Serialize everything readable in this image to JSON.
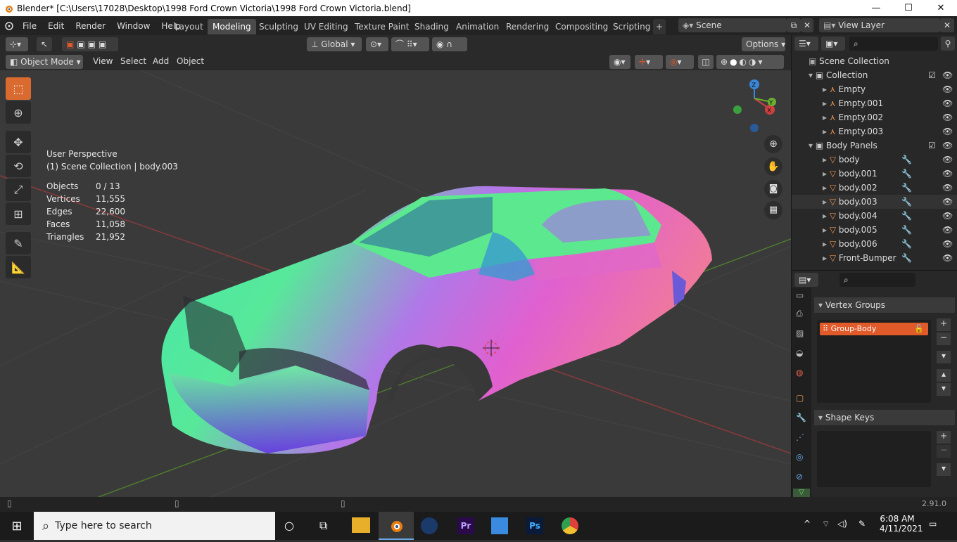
{
  "window": {
    "title": "Blender* [C:\\Users\\17028\\Desktop\\1998 Ford Crown Victoria\\1998 Ford Crown Victoria.blend]",
    "min": "—",
    "max": "☐",
    "close": "✕"
  },
  "menu": [
    "File",
    "Edit",
    "Render",
    "Window",
    "Help"
  ],
  "workspaces": [
    {
      "label": "Layout",
      "active": false
    },
    {
      "label": "Modeling",
      "active": true
    },
    {
      "label": "Sculpting",
      "active": false
    },
    {
      "label": "UV Editing",
      "active": false
    },
    {
      "label": "Texture Paint",
      "active": false
    },
    {
      "label": "Shading",
      "active": false
    },
    {
      "label": "Animation",
      "active": false
    },
    {
      "label": "Rendering",
      "active": false
    },
    {
      "label": "Compositing",
      "active": false
    },
    {
      "label": "Scripting",
      "active": false
    }
  ],
  "add_workspace": "+",
  "scene": {
    "name": "Scene",
    "view_layer": "View Layer"
  },
  "toolheader": {
    "orientation": "Global",
    "options": "Options"
  },
  "viewport_header": {
    "mode": "Object Mode",
    "menus": [
      "View",
      "Select",
      "Add",
      "Object"
    ]
  },
  "overlay": {
    "perspective": "User Perspective",
    "collection": "(1) Scene Collection | body.003"
  },
  "stats": [
    {
      "label": "Objects",
      "value": "0 / 13"
    },
    {
      "label": "Vertices",
      "value": "11,555"
    },
    {
      "label": "Edges",
      "value": "22,600"
    },
    {
      "label": "Faces",
      "value": "11,058"
    },
    {
      "label": "Triangles",
      "value": "21,952"
    }
  ],
  "gizmo": {
    "x": "X",
    "y": "Y",
    "z": "Z"
  },
  "outliner": {
    "root": "Scene Collection",
    "items": [
      {
        "label": "Collection",
        "type": "collection",
        "depth": 1
      },
      {
        "label": "Empty",
        "type": "empty",
        "depth": 2
      },
      {
        "label": "Empty.001",
        "type": "empty",
        "depth": 2
      },
      {
        "label": "Empty.002",
        "type": "empty",
        "depth": 2
      },
      {
        "label": "Empty.003",
        "type": "empty",
        "depth": 2
      },
      {
        "label": "Body Panels",
        "type": "collection",
        "depth": 1
      },
      {
        "label": "body",
        "type": "mesh",
        "depth": 2
      },
      {
        "label": "body.001",
        "type": "mesh",
        "depth": 2
      },
      {
        "label": "body.002",
        "type": "mesh",
        "depth": 2
      },
      {
        "label": "body.003",
        "type": "mesh",
        "depth": 2
      },
      {
        "label": "body.004",
        "type": "mesh",
        "depth": 2
      },
      {
        "label": "body.005",
        "type": "mesh",
        "depth": 2
      },
      {
        "label": "body.006",
        "type": "mesh",
        "depth": 2
      },
      {
        "label": "Front-Bumper",
        "type": "mesh",
        "depth": 2
      }
    ]
  },
  "properties": {
    "vertex_groups_title": "Vertex Groups",
    "vertex_group_item": "Group-Body",
    "shape_keys_title": "Shape Keys"
  },
  "version": "2.91.0",
  "taskbar": {
    "search_placeholder": "Type here to search",
    "time": "6:08 AM",
    "date": "4/11/2021"
  },
  "colors": {
    "accent": "#d96b30",
    "active_tab": "#4a4a4a",
    "selection": "#e05a2a"
  }
}
